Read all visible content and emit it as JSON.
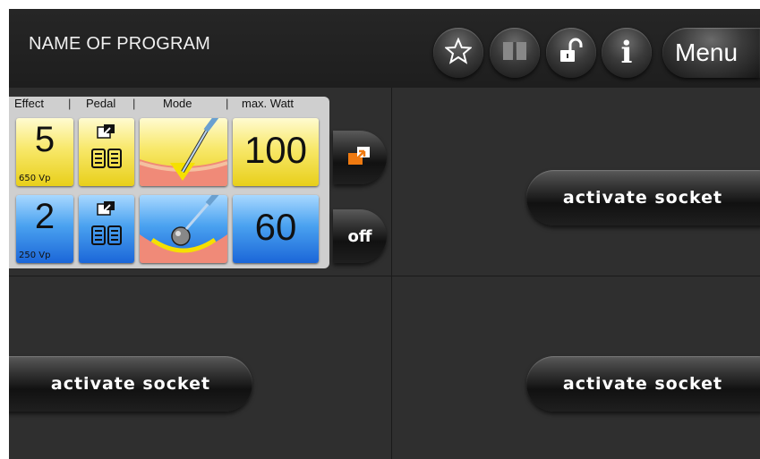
{
  "header": {
    "program_name": "NAME OF PROGRAM",
    "buttons": {
      "favorite": "favorite",
      "book": "book",
      "lock": "unlocked",
      "info": "i",
      "menu": "Menu"
    }
  },
  "panel": {
    "columns": [
      "Effect",
      "Pedal",
      "Mode",
      "max. Watt"
    ],
    "rows": [
      {
        "effect": "5",
        "voltage": "650 Vp",
        "watt": "100",
        "color": "#f8e86a"
      },
      {
        "effect": "2",
        "voltage": "250 Vp",
        "watt": "60",
        "color": "#4aa2f0"
      }
    ],
    "side_buttons": {
      "off": "off"
    }
  },
  "sockets": {
    "top_right": "activate socket",
    "bottom_left": "activate socket",
    "bottom_right": "activate socket"
  }
}
